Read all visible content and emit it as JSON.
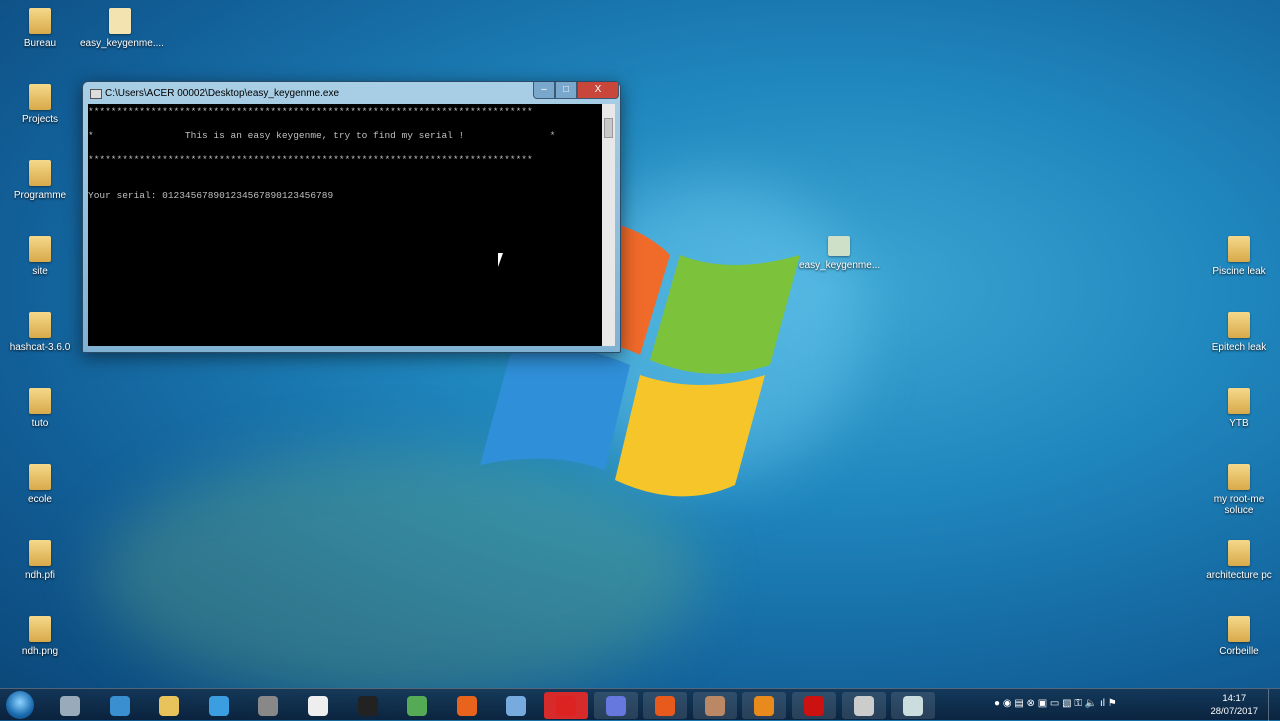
{
  "desktop_left": [
    {
      "label": "Bureau"
    },
    {
      "label": "Projects"
    },
    {
      "label": "Programme"
    },
    {
      "label": "site"
    },
    {
      "label": "hashcat-3.6.0"
    },
    {
      "label": "tuto"
    },
    {
      "label": "ecole"
    },
    {
      "label": "ndh.pfi"
    },
    {
      "label": "ndh.png"
    }
  ],
  "desktop_top": {
    "label": "easy_keygenme...."
  },
  "desktop_middle": {
    "label": "easy_keygenme..."
  },
  "desktop_right": [
    {
      "label": "Piscine leak"
    },
    {
      "label": "Epitech leak"
    },
    {
      "label": "YTB"
    },
    {
      "label": "my root-me soluce"
    },
    {
      "label": "architecture pc"
    },
    {
      "label": "Corbeille"
    }
  ],
  "window": {
    "title": "C:\\Users\\ACER 00002\\Desktop\\easy_keygenme.exe",
    "minimize": "–",
    "maximize": "□",
    "close": "X",
    "console": {
      "border": "******************************************************************************",
      "banner": "*                This is an easy keygenme, try to find my serial !               *",
      "prompt": "Your serial: ",
      "input": "012345678901234567890123456789"
    }
  },
  "taskbar": {
    "start": "start-orb",
    "apps": [
      "explorer",
      "audacity",
      "file-manager",
      "media-player",
      "app",
      "notepad",
      "cmd",
      "globe",
      "firefox",
      "network",
      "opera",
      "discord",
      "x-app",
      "avatar",
      "sublime",
      "adobe",
      "windows-app",
      "keygenme"
    ]
  },
  "clock": {
    "time": "14:17",
    "date": "28/07/2017"
  }
}
